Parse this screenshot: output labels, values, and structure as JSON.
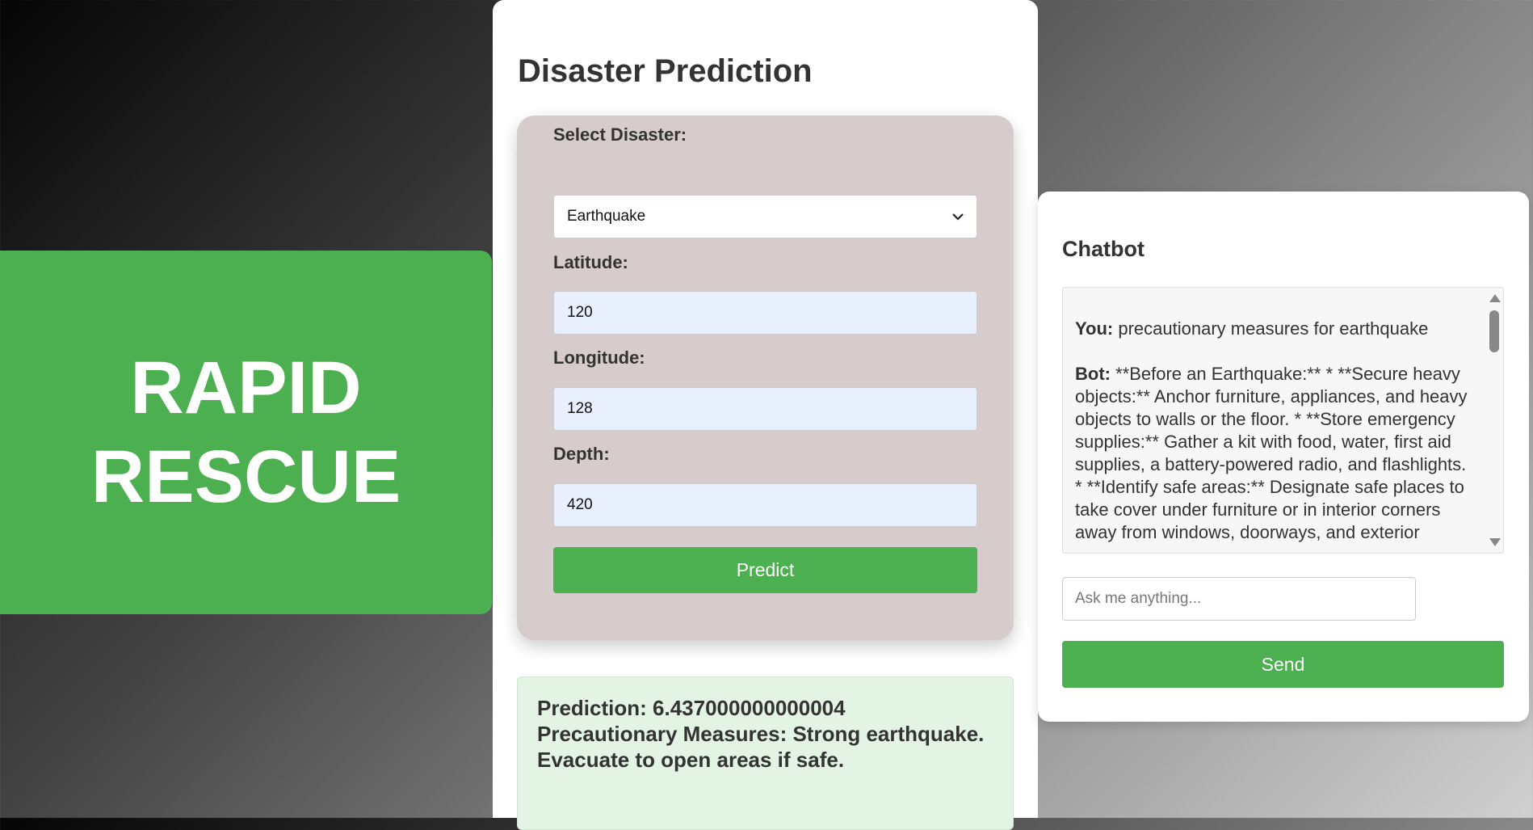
{
  "brand": {
    "line1": "RAPID",
    "line2": "RESCUE"
  },
  "prediction_panel": {
    "title": "Disaster Prediction",
    "select_label": "Select Disaster:",
    "select_value": "Earthquake",
    "latitude_label": "Latitude:",
    "latitude_value": "120",
    "longitude_label": "Longitude:",
    "longitude_value": "128",
    "depth_label": "Depth:",
    "depth_value": "420",
    "predict_label": "Predict",
    "result": {
      "prediction": "Prediction: 6.437000000000004",
      "measures": "Precautionary Measures: Strong earthquake. Evacuate to open areas if safe."
    }
  },
  "chatbot": {
    "title": "Chatbot",
    "messages": [
      {
        "speaker": "You:",
        "text": " precautionary measures for earthquake"
      },
      {
        "speaker": "Bot:",
        "text": " **Before an Earthquake:** * **Secure heavy objects:** Anchor furniture, appliances, and heavy objects to walls or the floor. * **Store emergency supplies:** Gather a kit with food, water, first aid supplies, a battery-powered radio, and flashlights. * **Identify safe areas:** Designate safe places to take cover under furniture or in interior corners away from windows, doorways, and exterior"
      }
    ],
    "input_placeholder": "Ask me anything...",
    "send_label": "Send"
  },
  "colors": {
    "accent": "#4caf50",
    "form_bg": "#d6cccc",
    "result_bg": "#e4f4e4"
  }
}
